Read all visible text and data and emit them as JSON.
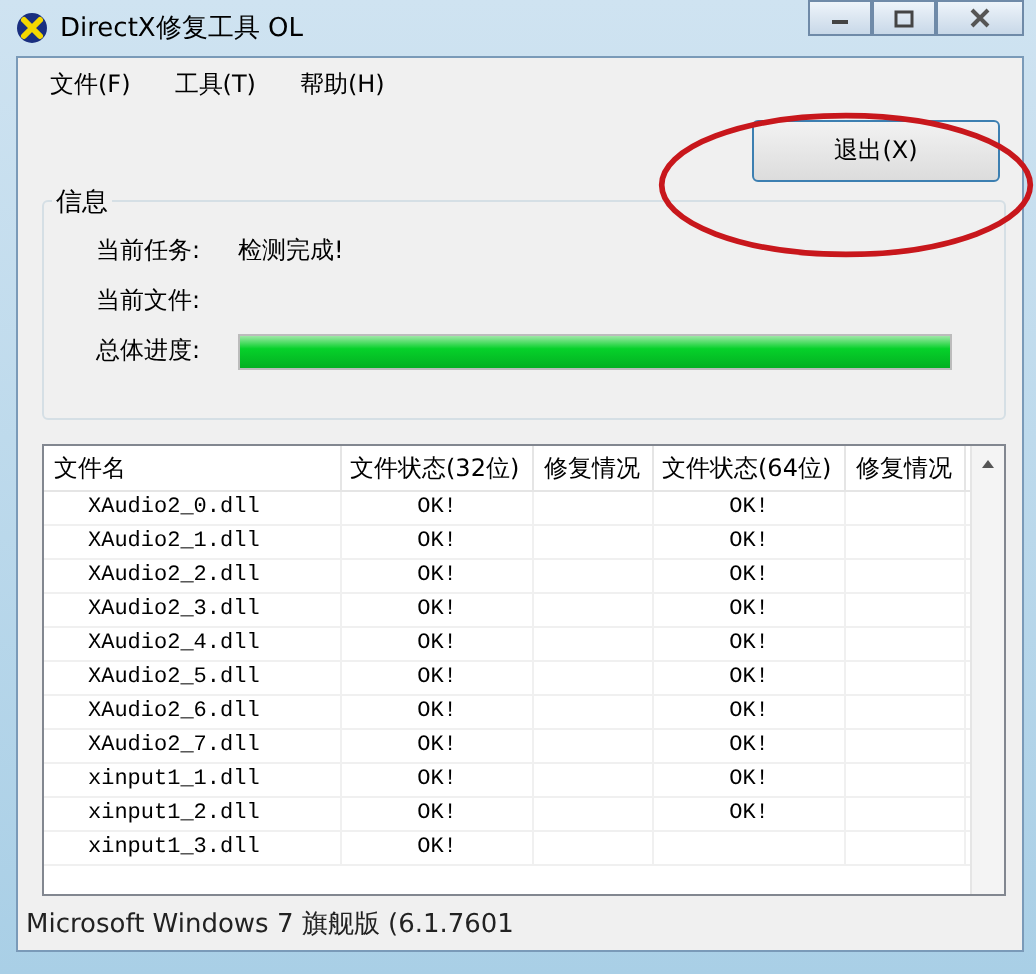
{
  "window": {
    "title": "DirectX修复工具 OL"
  },
  "menu": [
    "文件(F)",
    "工具(T)",
    "帮助(H)"
  ],
  "exit_button": "退出(X)",
  "info": {
    "title": "信息",
    "fields": [
      {
        "label": "当前任务:",
        "value": "检测完成!"
      },
      {
        "label": "当前文件:"
      }
    ],
    "progress": {
      "label": "总体进度:",
      "level": 1
    }
  },
  "table": {
    "columns": [
      "文件名",
      "文件状态(32位)",
      "修复情况",
      "文件状态(64位)",
      "修复情况"
    ],
    "rows": [
      {
        "name": "XAudio2_0.dll",
        "status32": "OK!",
        "status64": "OK!"
      },
      {
        "name": "XAudio2_1.dll",
        "status32": "OK!",
        "status64": "OK!"
      },
      {
        "name": "XAudio2_2.dll",
        "status32": "OK!",
        "status64": "OK!"
      },
      {
        "name": "XAudio2_3.dll",
        "status32": "OK!",
        "status64": "OK!"
      },
      {
        "name": "XAudio2_4.dll",
        "status32": "OK!",
        "status64": "OK!"
      },
      {
        "name": "XAudio2_5.dll",
        "status32": "OK!",
        "status64": "OK!"
      },
      {
        "name": "XAudio2_6.dll",
        "status32": "OK!",
        "status64": "OK!"
      },
      {
        "name": "XAudio2_7.dll",
        "status32": "OK!",
        "status64": "OK!"
      },
      {
        "name": "xinput1_1.dll",
        "status32": "OK!",
        "status64": "OK!"
      },
      {
        "name": "xinput1_2.dll",
        "status32": "OK!",
        "status64": "OK!"
      },
      {
        "name": "xinput1_3.dll",
        "status32": "OK!"
      }
    ]
  },
  "status_bar": "Microsoft Windows 7 旗舰版 (6.1.7601"
}
